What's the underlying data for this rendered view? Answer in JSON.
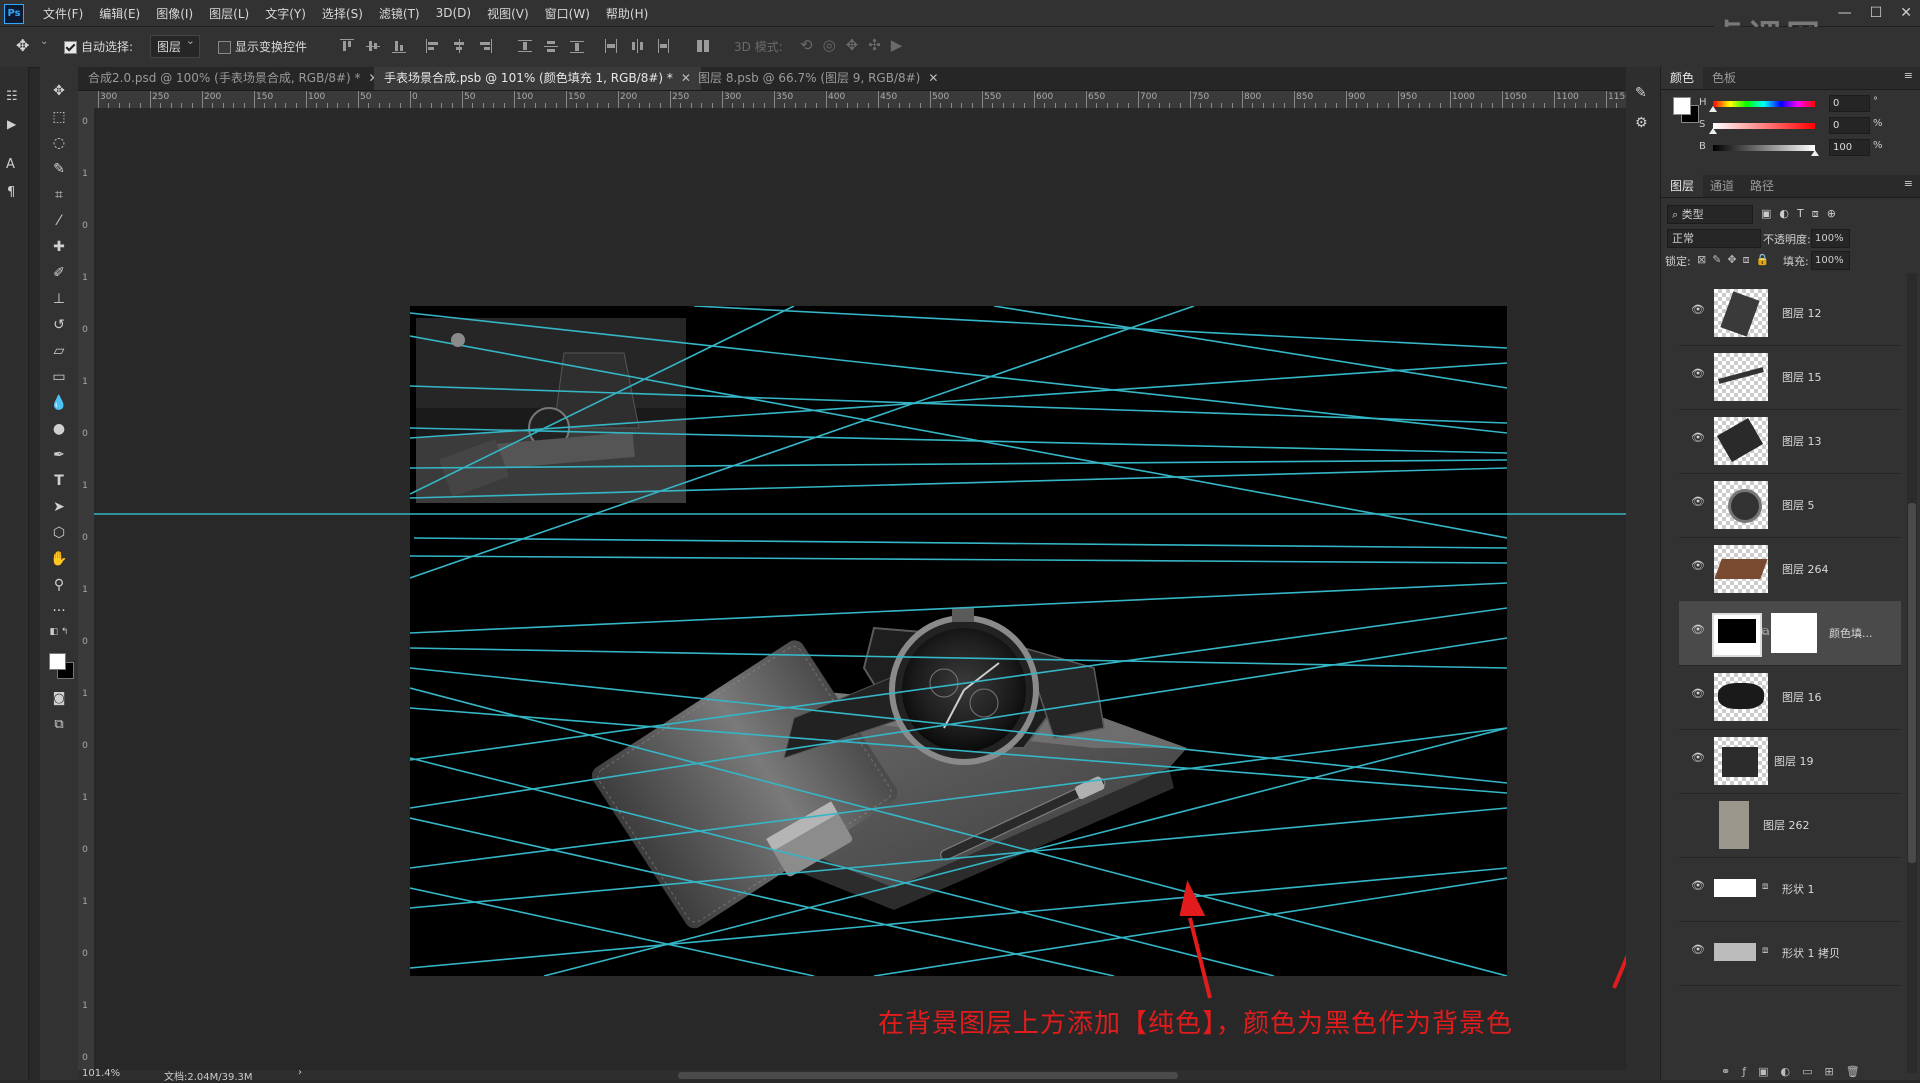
{
  "app": {
    "logo": "Ps"
  },
  "menu": [
    "文件(F)",
    "编辑(E)",
    "图像(I)",
    "图层(L)",
    "文字(Y)",
    "选择(S)",
    "滤镜(T)",
    "3D(D)",
    "视图(V)",
    "窗口(W)",
    "帮助(H)"
  ],
  "options": {
    "auto_select_label": "自动选择:",
    "auto_select_checked": true,
    "auto_select_value": "图层",
    "show_transform_label": "显示变换控件",
    "show_transform_checked": false,
    "mode_3d_label": "3D 模式:"
  },
  "tabs": [
    {
      "label": "合成2.0.psd @ 100% (手表场景合成, RGB/8#) *",
      "active": false
    },
    {
      "label": "手表场景合成.psb @ 101% (颜色填充 1, RGB/8#) *",
      "active": true
    },
    {
      "label": "图层 8.psb @ 66.7% (图层 9, RGB/8#)",
      "active": false
    }
  ],
  "ruler_top": [
    "300",
    "250",
    "200",
    "150",
    "100",
    "50",
    "0",
    "50",
    "100",
    "150",
    "200",
    "250",
    "300",
    "350",
    "400",
    "450",
    "500",
    "550",
    "600",
    "650",
    "700",
    "750",
    "800",
    "850",
    "900",
    "950",
    "1000",
    "1050",
    "1100",
    "1150"
  ],
  "status": {
    "zoom": "101.4%",
    "doc": "文档:2.04M/39.3M"
  },
  "color_panel": {
    "tabs": [
      "颜色",
      "色板"
    ],
    "h_label": "H",
    "h_value": "0",
    "h_unit": "°",
    "s_label": "S",
    "s_value": "0",
    "s_unit": "%",
    "b_label": "B",
    "b_value": "100",
    "b_unit": "%",
    "h_level": 0,
    "s_level": 0,
    "b_level": 100
  },
  "layers_panel": {
    "tabs": [
      "图层",
      "通道",
      "路径"
    ],
    "filter_label": "类型",
    "blend_mode": "正常",
    "opacity_label": "不透明度:",
    "opacity_value": "100%",
    "lock_label": "锁定:",
    "fill_label": "填充:",
    "fill_value": "100%",
    "layers": [
      {
        "name": "图层 12",
        "visible": true
      },
      {
        "name": "图层 15",
        "visible": true
      },
      {
        "name": "图层 13",
        "visible": true
      },
      {
        "name": "图层 5",
        "visible": true
      },
      {
        "name": "图层 264",
        "visible": true
      },
      {
        "name": "颜色填...",
        "visible": true,
        "selected": true
      },
      {
        "name": "图层 16",
        "visible": true
      },
      {
        "name": "图层 19",
        "visible": true
      },
      {
        "name": "图层 262",
        "visible": false
      },
      {
        "name": "形状 1",
        "visible": true
      },
      {
        "name": "形状 1 拷贝",
        "visible": true
      }
    ]
  },
  "watermark": "虎课网",
  "caption": "在背景图层上方添加【纯色】，颜色为黑色作为背景色",
  "colors": {
    "guide": "#35b6c6",
    "annotation": "#e21c1c",
    "panel": "#323232",
    "canvas_bg": "#282828"
  }
}
